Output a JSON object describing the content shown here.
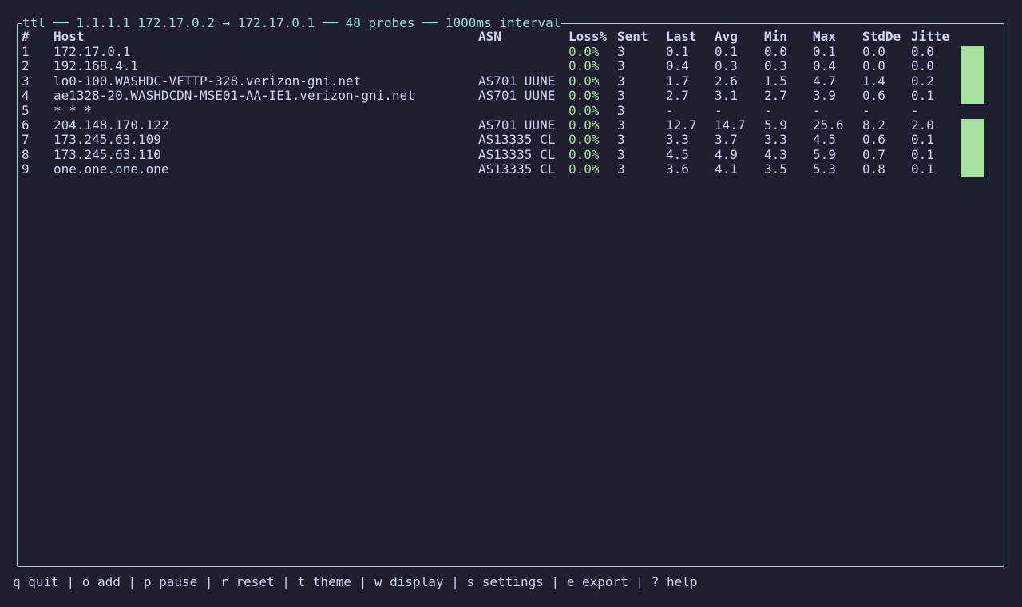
{
  "title": {
    "prefix": "ttl",
    "sep": "──",
    "target": "1.1.1.1",
    "source": "172.17.0.2",
    "arrow": "→",
    "gateway": "172.17.0.1",
    "probes": "48 probes",
    "interval": "1000ms interval"
  },
  "columns": {
    "num": "#",
    "host": "Host",
    "asn": "ASN",
    "loss": "Loss%",
    "sent": "Sent",
    "last": "Last",
    "avg": "Avg",
    "min": "Min",
    "max": "Max",
    "stddev": "StdDe",
    "jitter": "Jitte"
  },
  "hops": [
    {
      "num": "1",
      "host": "172.17.0.1",
      "asn": "",
      "loss": "0.0%",
      "sent": "3",
      "last": "0.1",
      "avg": "0.1",
      "min": "0.0",
      "max": "0.1",
      "stddev": "0.0",
      "jitter": "0.0"
    },
    {
      "num": "2",
      "host": "192.168.4.1",
      "asn": "",
      "loss": "0.0%",
      "sent": "3",
      "last": "0.4",
      "avg": "0.3",
      "min": "0.3",
      "max": "0.4",
      "stddev": "0.0",
      "jitter": "0.0"
    },
    {
      "num": "3",
      "host": "lo0-100.WASHDC-VFTTP-328.verizon-gni.net",
      "asn": "AS701 UUNE",
      "loss": "0.0%",
      "sent": "3",
      "last": "1.7",
      "avg": "2.6",
      "min": "1.5",
      "max": "4.7",
      "stddev": "1.4",
      "jitter": "0.2"
    },
    {
      "num": "4",
      "host": "ae1328-20.WASHDCDN-MSE01-AA-IE1.verizon-gni.net",
      "asn": "AS701 UUNE",
      "loss": "0.0%",
      "sent": "3",
      "last": "2.7",
      "avg": "3.1",
      "min": "2.7",
      "max": "3.9",
      "stddev": "0.6",
      "jitter": "0.1"
    },
    {
      "num": "5",
      "host": "* * *",
      "asn": "",
      "loss": "0.0%",
      "sent": "3",
      "last": "-",
      "avg": "-",
      "min": "-",
      "max": "-",
      "stddev": "-",
      "jitter": "-"
    },
    {
      "num": "6",
      "host": "204.148.170.122",
      "asn": "AS701 UUNE",
      "loss": "0.0%",
      "sent": "3",
      "last": "12.7",
      "avg": "14.7",
      "min": "5.9",
      "max": "25.6",
      "stddev": "8.2",
      "jitter": "2.0"
    },
    {
      "num": "7",
      "host": "173.245.63.109",
      "asn": "AS13335 CL",
      "loss": "0.0%",
      "sent": "3",
      "last": "3.3",
      "avg": "3.7",
      "min": "3.3",
      "max": "4.5",
      "stddev": "0.6",
      "jitter": "0.1"
    },
    {
      "num": "8",
      "host": "173.245.63.110",
      "asn": "AS13335 CL",
      "loss": "0.0%",
      "sent": "3",
      "last": "4.5",
      "avg": "4.9",
      "min": "4.3",
      "max": "5.9",
      "stddev": "0.7",
      "jitter": "0.1"
    },
    {
      "num": "9",
      "host": "one.one.one.one",
      "asn": "AS13335 CL",
      "loss": "0.0%",
      "sent": "3",
      "last": "3.6",
      "avg": "4.1",
      "min": "3.5",
      "max": "5.3",
      "stddev": "0.8",
      "jitter": "0.1"
    }
  ],
  "footer": {
    "quit": "q quit",
    "add": "o add",
    "pause": "p pause",
    "reset": "r reset",
    "theme": "t theme",
    "display": "w display",
    "settings": "s settings",
    "export": "e export",
    "help": "? help",
    "divider": "|"
  },
  "colors": {
    "background": "#1e1e2e",
    "border": "#94e2d5",
    "text": "#cdd6f4",
    "loss_ok": "#a6e3a1",
    "spark": "#a6e3a1"
  }
}
